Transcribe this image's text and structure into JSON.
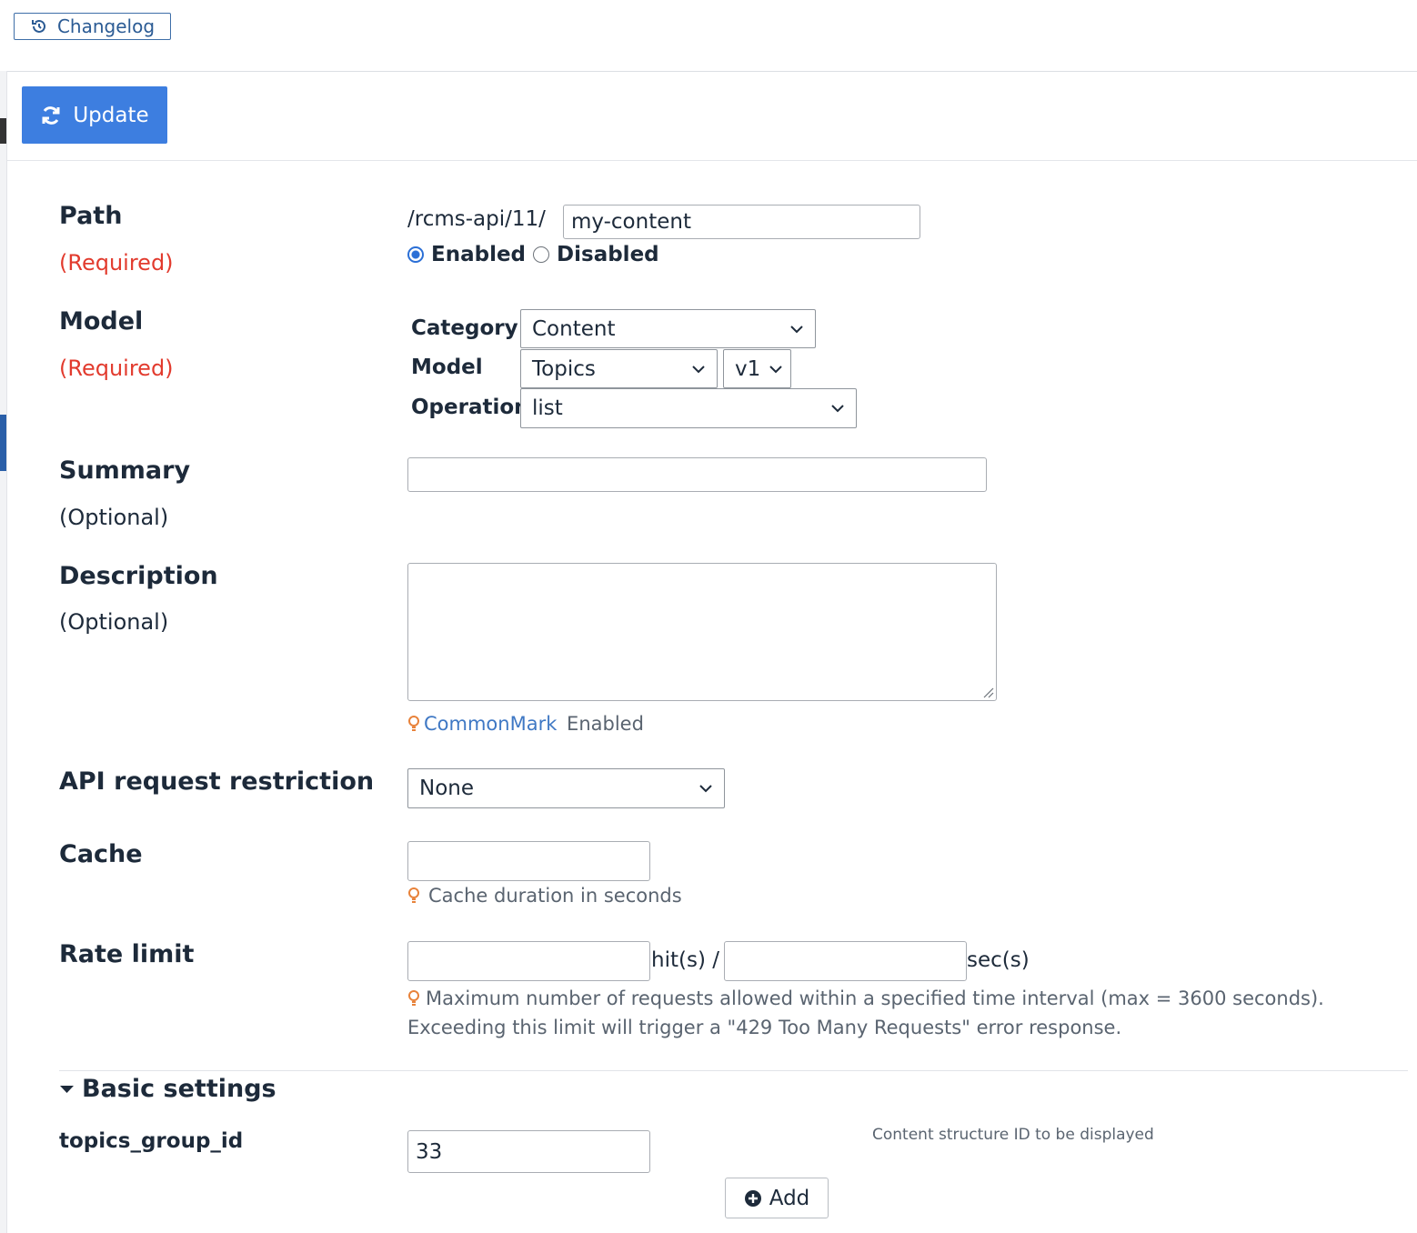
{
  "header": {
    "changelog_label": "Changelog",
    "update_label": "Update"
  },
  "path": {
    "label": "Path",
    "required": "(Required)",
    "prefix": "/rcms-api/11/",
    "value": "my-content",
    "enabled_label": "Enabled",
    "disabled_label": "Disabled",
    "selected": "Enabled"
  },
  "model": {
    "label": "Model",
    "required": "(Required)",
    "category_label": "Category",
    "category_value": "Content",
    "model_label": "Model",
    "model_value": "Topics",
    "version_value": "v1",
    "operation_label": "Operation",
    "operation_value": "list"
  },
  "summary": {
    "label": "Summary",
    "optional": "(Optional)",
    "value": ""
  },
  "description": {
    "label": "Description",
    "optional": "(Optional)",
    "value": "",
    "hint_link": "CommonMark",
    "hint_text": " Enabled"
  },
  "api_restriction": {
    "label": "API request restriction",
    "value": "None"
  },
  "cache": {
    "label": "Cache",
    "value": "",
    "hint": "Cache duration in seconds"
  },
  "rate_limit": {
    "label": "Rate limit",
    "hits_value": "",
    "hits_unit": "hit(s) /",
    "secs_value": "",
    "secs_unit": "sec(s)",
    "hint": "Maximum number of requests allowed within a specified time interval (max = 3600 seconds). Exceeding this limit will trigger a \"429 Too Many Requests\" error response."
  },
  "basic_settings": {
    "title": "Basic settings",
    "param_label": "topics_group_id",
    "param_value": "33",
    "param_hint": "Content structure ID to be displayed",
    "add_label": "Add"
  },
  "colors": {
    "accent": "#3d7ee0",
    "required": "#e23b2e",
    "hint_icon": "#e8823a",
    "link": "#3f78c4"
  }
}
